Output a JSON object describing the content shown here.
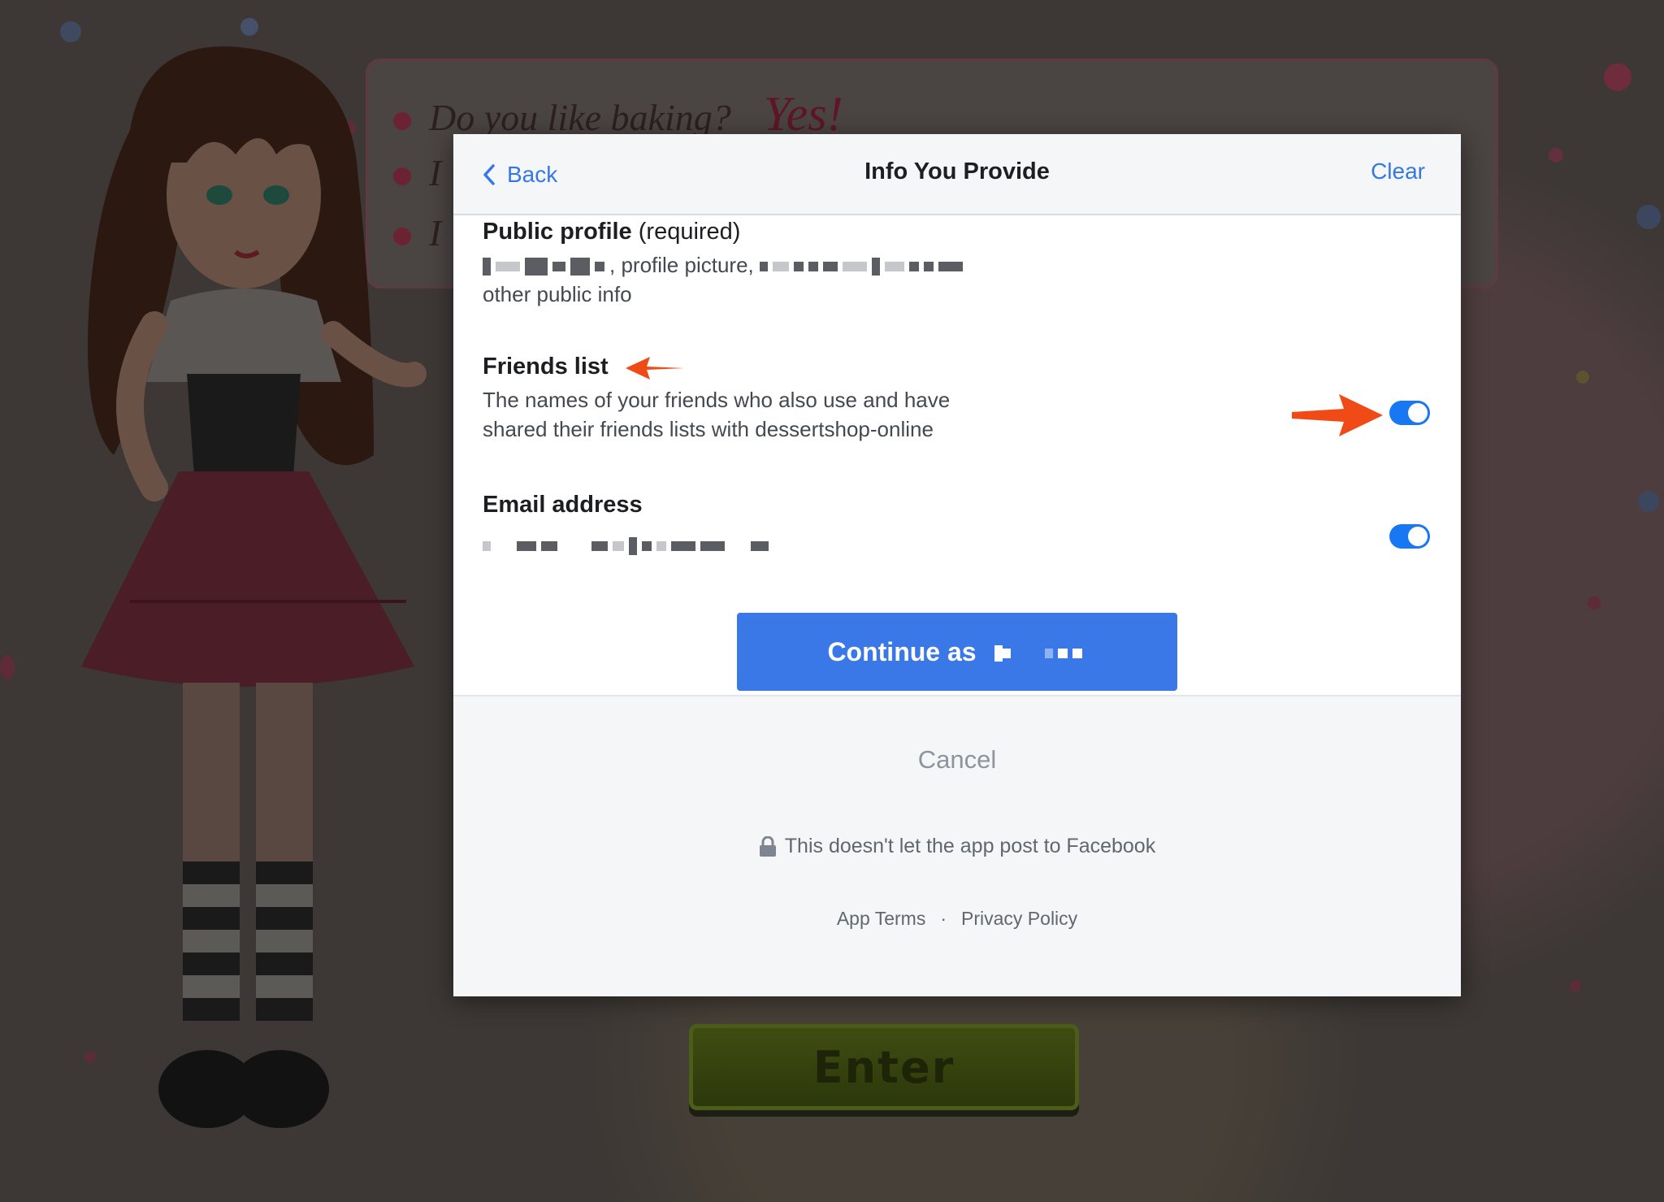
{
  "background": {
    "questions": [
      {
        "text": "Do you like baking?",
        "answer": "Yes!"
      },
      {
        "text": "I",
        "answer": ""
      },
      {
        "text": "I",
        "answer": ""
      }
    ],
    "enter_label": "Enter"
  },
  "dialog": {
    "back_label": "Back",
    "title": "Info You Provide",
    "clear_label": "Clear",
    "permissions": {
      "public_profile": {
        "title": "Public profile",
        "required": "(required)",
        "desc_middle": ", profile picture,",
        "desc_end": "other public info"
      },
      "friends_list": {
        "title": "Friends list",
        "desc_line1": "The names of your friends who also use and have",
        "desc_line2": "shared their friends lists with dessertshop-online",
        "enabled": true
      },
      "email": {
        "title": "Email address",
        "enabled": true
      }
    },
    "continue_label": "Continue as",
    "cancel_label": "Cancel",
    "no_post_note": "This doesn't let the app post to Facebook",
    "footer": {
      "app_terms": "App Terms",
      "separator": "·",
      "privacy_policy": "Privacy Policy"
    }
  },
  "colors": {
    "link_blue": "#3578e5",
    "button_blue": "#3b78e7",
    "toggle_blue": "#1877f2",
    "annotation_arrow": "#f04a16"
  },
  "icons": [
    "chevron-left-icon",
    "lock-icon",
    "annotation-arrow"
  ]
}
